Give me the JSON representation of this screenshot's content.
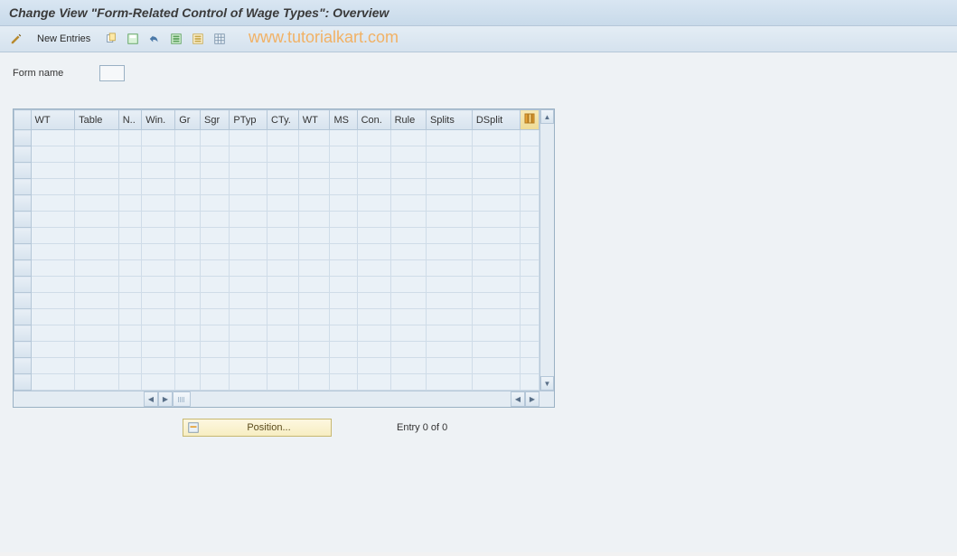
{
  "title": "Change View \"Form-Related Control of Wage Types\": Overview",
  "watermark": "www.tutorialkart.com",
  "toolbar": {
    "new_entries_label": "New Entries"
  },
  "form": {
    "form_name_label": "Form name",
    "form_name_value": ""
  },
  "grid": {
    "columns": [
      "WT",
      "Table",
      "N..",
      "Win.",
      "Gr",
      "Sgr",
      "PTyp",
      "CTy.",
      "WT",
      "MS",
      "Con.",
      "Rule",
      "Splits",
      "DSplit"
    ],
    "row_count": 16,
    "rows": []
  },
  "footer": {
    "position_label": "Position...",
    "entry_text": "Entry 0 of 0"
  },
  "icons": {
    "pencil": "pencil-icon",
    "copy": "copy-icon",
    "save_table": "save-table-icon",
    "undo": "undo-icon",
    "select_all": "select-all-icon",
    "deselect_all": "deselect-all-icon",
    "table_settings": "table-settings-icon",
    "config_col": "config-column-icon",
    "position_icon": "position-icon"
  }
}
